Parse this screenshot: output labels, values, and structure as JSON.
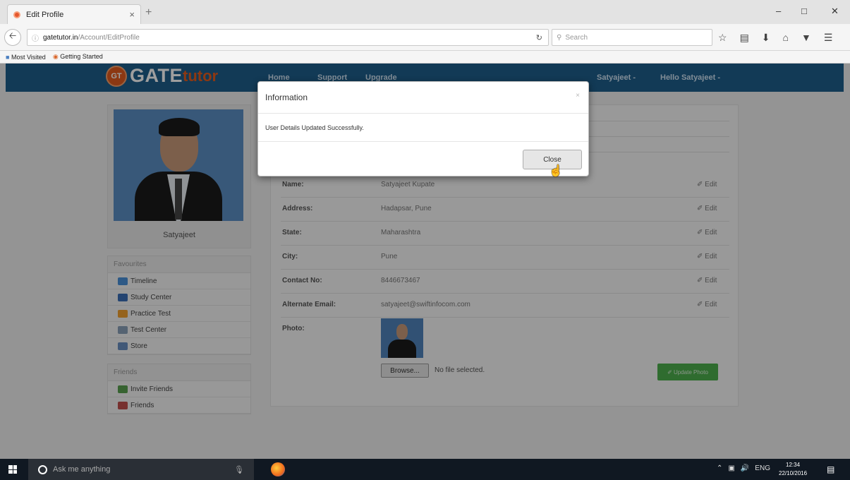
{
  "browser": {
    "tab_title": "Edit Profile",
    "tab_close": "×",
    "new_tab": "+",
    "url_host": "gatetutor.in",
    "url_path": "/Account/EditProfile",
    "search_placeholder": "Search",
    "bookmarks": [
      "Most Visited",
      "Getting Started"
    ]
  },
  "site": {
    "logo_badge": "GT",
    "logo_gate": "GATE",
    "logo_tutor": "tutor",
    "nav": [
      "Home",
      "Support",
      "Upgrade"
    ],
    "user_menu": "Satyajeet -",
    "greeting_menu": "Hello Satyajeet -"
  },
  "sidebar": {
    "profile_name": "Satyajeet",
    "favourites_heading": "Favourites",
    "favourites": [
      {
        "label": "Timeline",
        "color": "#4a90d9"
      },
      {
        "label": "Study Center",
        "color": "#3b6fb6"
      },
      {
        "label": "Practice Test",
        "color": "#f0a030"
      },
      {
        "label": "Test Center",
        "color": "#8aa0b8"
      },
      {
        "label": "Store",
        "color": "#6a8fc0"
      }
    ],
    "friends_heading": "Friends",
    "friends": [
      {
        "label": "Invite Friends",
        "color": "#5aa050"
      },
      {
        "label": "Friends",
        "color": "#c0504d"
      }
    ]
  },
  "profile": {
    "edit_label": "Edit",
    "fields": [
      {
        "label": "Name:",
        "value": "Satyajeet Kupate"
      },
      {
        "label": "Address:",
        "value": "Hadapsar, Pune"
      },
      {
        "label": "State:",
        "value": "Maharashtra"
      },
      {
        "label": "City:",
        "value": "Pune"
      },
      {
        "label": "Contact No:",
        "value": "8446673467"
      },
      {
        "label": "Alternate Email:",
        "value": "satyajeet@swiftinfocom.com"
      }
    ],
    "photo_label": "Photo:",
    "browse_label": "Browse...",
    "no_file": "No file selected.",
    "update_photo": "Update Photo"
  },
  "modal": {
    "title": "Information",
    "close_x": "×",
    "message": "User Details Updated Successfully.",
    "close_button": "Close"
  },
  "taskbar": {
    "search_placeholder": "Ask me anything",
    "lang": "ENG",
    "time": "12:34",
    "date": "22/10/2016"
  }
}
